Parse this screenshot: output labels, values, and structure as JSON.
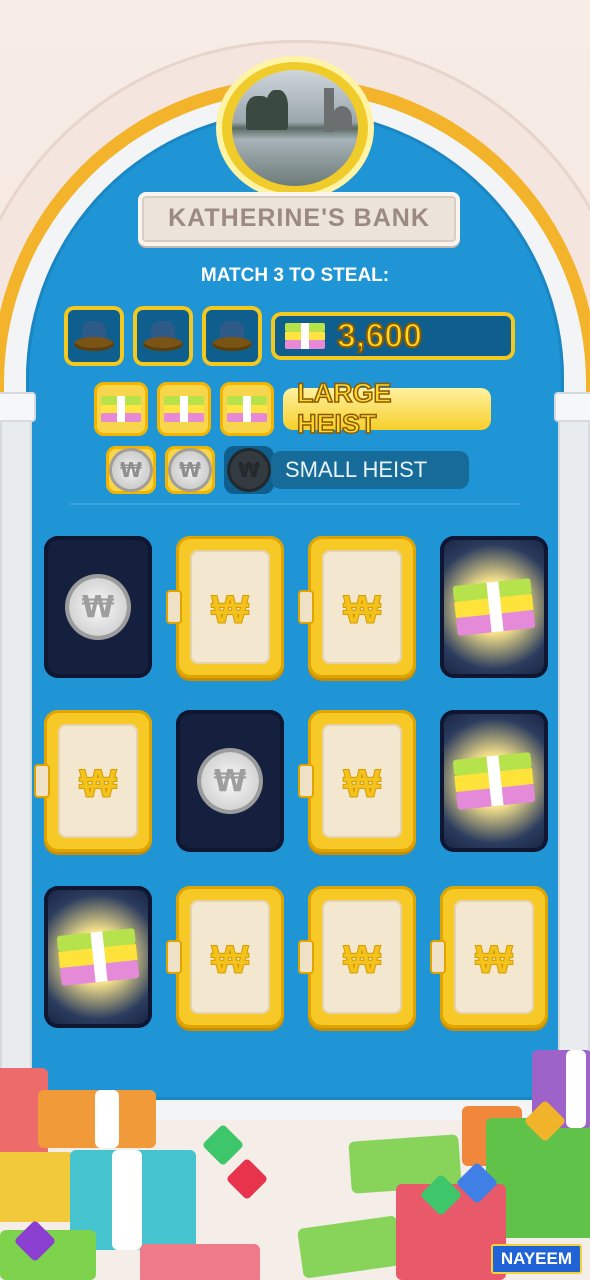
{
  "bank": {
    "name": "KATHERINE'S BANK",
    "subtitle": "MATCH 3 TO STEAL:"
  },
  "rewards": [
    {
      "tier": "jackpot",
      "icon": "hat-icon",
      "matched": 0,
      "value": "3,600"
    },
    {
      "tier": "large",
      "icon": "cash-stack-icon",
      "matched": 3,
      "label": "LARGE HEIST"
    },
    {
      "tier": "small",
      "icon": "coin-icon",
      "matched": 2,
      "label": "SMALL HEIST"
    }
  ],
  "board": {
    "tiles": [
      {
        "state": "open",
        "content": "coin"
      },
      {
        "state": "closed"
      },
      {
        "state": "closed"
      },
      {
        "state": "open",
        "content": "cash"
      },
      {
        "state": "closed"
      },
      {
        "state": "open",
        "content": "coin"
      },
      {
        "state": "closed"
      },
      {
        "state": "open",
        "content": "cash"
      },
      {
        "state": "open",
        "content": "cash"
      },
      {
        "state": "closed"
      },
      {
        "state": "closed"
      },
      {
        "state": "closed"
      }
    ],
    "door_symbol": "₩"
  },
  "watermark": "NAYEEM",
  "colors": {
    "sky_blue": "#1f95d6",
    "gold": "#f6c927",
    "dark_slot": "#0f5f8e"
  }
}
